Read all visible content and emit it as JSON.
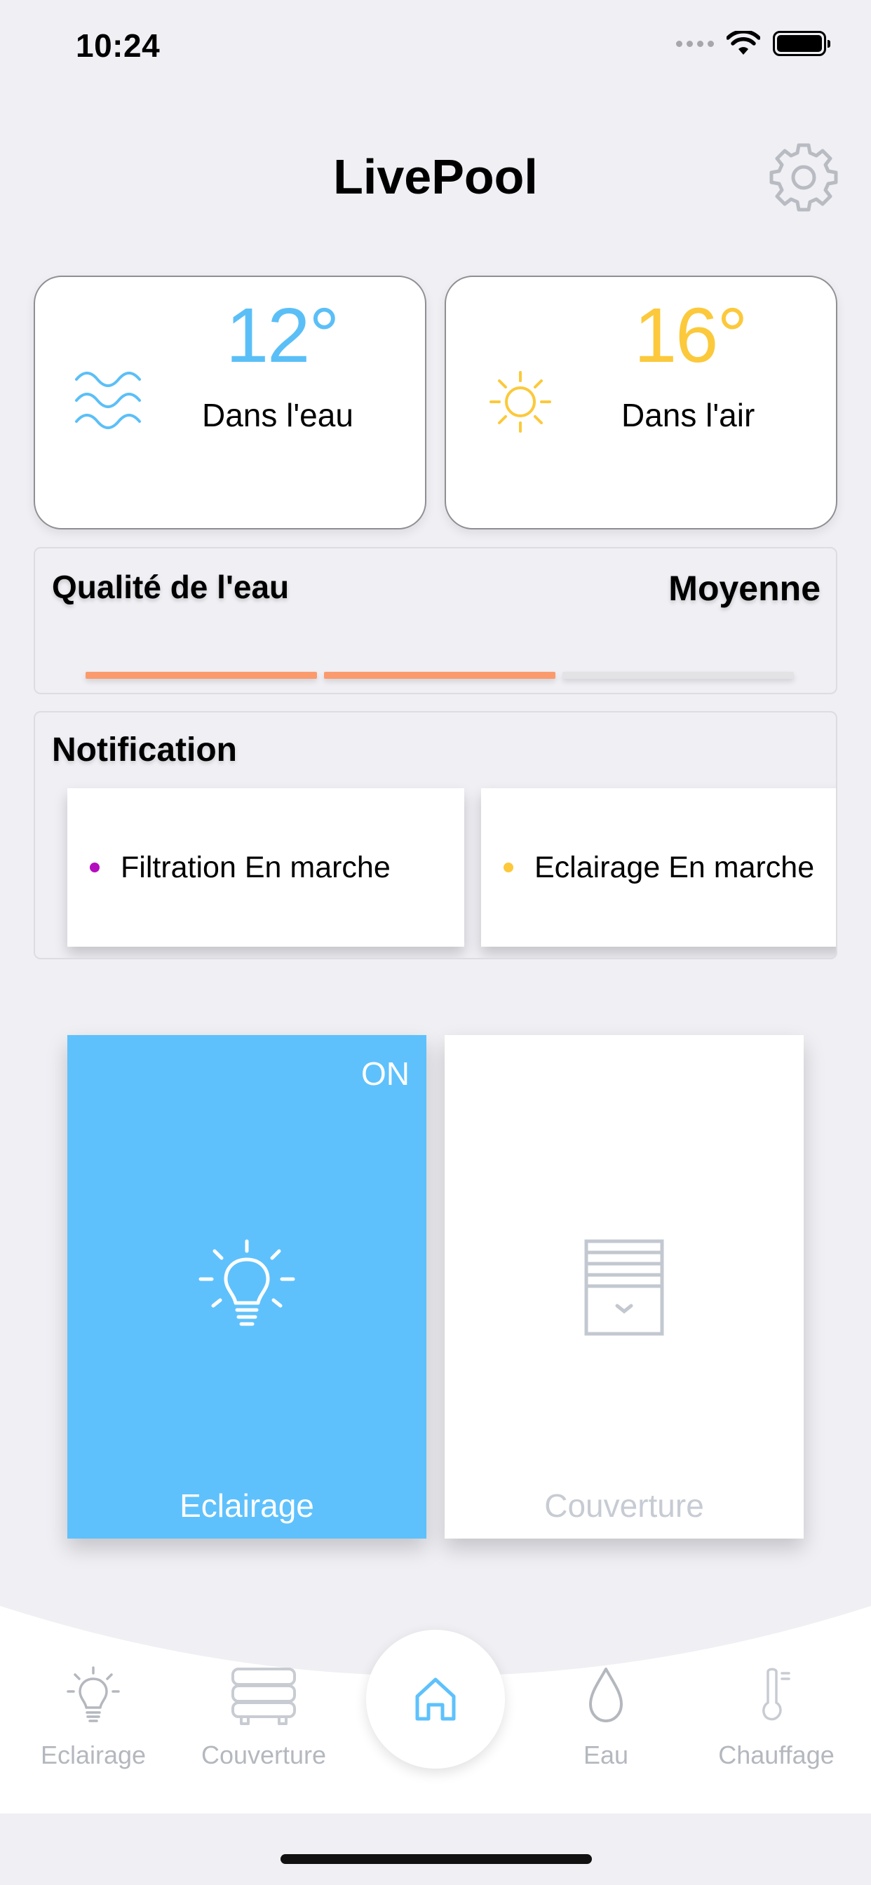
{
  "status_bar": {
    "time": "10:24"
  },
  "header": {
    "title": "LivePool"
  },
  "temperatures": {
    "water": {
      "value": "12°",
      "label": "Dans l'eau",
      "color": "#5bbff7",
      "icon": "waves-icon"
    },
    "air": {
      "value": "16°",
      "label": "Dans l'air",
      "color": "#fbc93b",
      "icon": "sun-icon"
    }
  },
  "water_quality": {
    "title": "Qualité de l'eau",
    "value": "Moyenne",
    "level_segments_filled": 2,
    "level_segments_total": 3,
    "fill_color": "#fb9b6d",
    "empty_color": "#e3e3e6"
  },
  "notifications": {
    "title": "Notification",
    "items": [
      {
        "text": "Filtration En marche",
        "dot_color": "#b40dbe"
      },
      {
        "text": "Eclairage En marche",
        "dot_color": "#fbc93b"
      }
    ]
  },
  "tiles": [
    {
      "label": "Eclairage",
      "state": "ON",
      "active": true,
      "icon": "bulb-icon"
    },
    {
      "label": "Couverture",
      "active": false,
      "icon": "blind-icon"
    }
  ],
  "tabbar": {
    "items": [
      {
        "label": "Eclairage",
        "icon": "bulb-icon"
      },
      {
        "label": "Couverture",
        "icon": "cover-icon"
      },
      {
        "label": "",
        "icon": "home-icon",
        "active": true
      },
      {
        "label": "Eau",
        "icon": "drop-icon"
      },
      {
        "label": "Chauffage",
        "icon": "thermometer-icon"
      }
    ]
  },
  "colors": {
    "accent_blue": "#5ec1fc",
    "inactive_gray": "#b4b8be"
  }
}
